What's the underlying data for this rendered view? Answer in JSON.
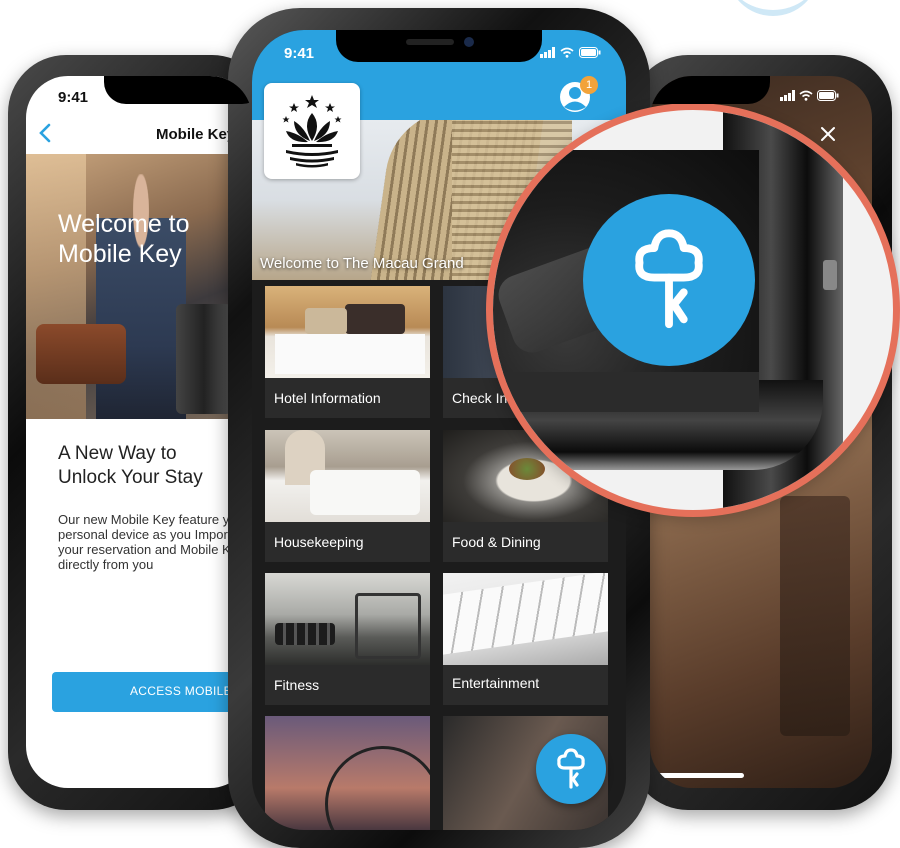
{
  "left_phone": {
    "time": "9:41",
    "back_icon": "chevron-left-icon",
    "nav_title": "Mobile Key",
    "hero_text": "Welcome to Mobile Key",
    "heading": "A New Way to Unlock Your Stay",
    "body": "Our new Mobile Key feature your personal device as you Import your reservation and Mobile Key directly from you",
    "button_label": "ACCESS MOBILE"
  },
  "center_phone": {
    "time": "9:41",
    "notification_count": "1",
    "avatar_icon": "user-avatar-icon",
    "logo_icon": "lotus-logo-icon",
    "banner_text": "Welcome to The Macau Grand",
    "tiles": [
      {
        "label": "Hotel Information"
      },
      {
        "label": "Check In"
      },
      {
        "label": "Housekeeping"
      },
      {
        "label": "Food & Dining"
      },
      {
        "label": "Fitness"
      },
      {
        "label": "Entertainment"
      },
      {
        "label": ""
      },
      {
        "label": ""
      }
    ],
    "fab_icon": "key-icon"
  },
  "right_phone": {
    "close_icon": "close-icon",
    "zoom_icon": "key-icon"
  },
  "colors": {
    "accent": "#2AA2E0",
    "zoom_ring": "#E5705A",
    "badge": "#F2A33A",
    "tile_bg": "#2B2B2B"
  }
}
